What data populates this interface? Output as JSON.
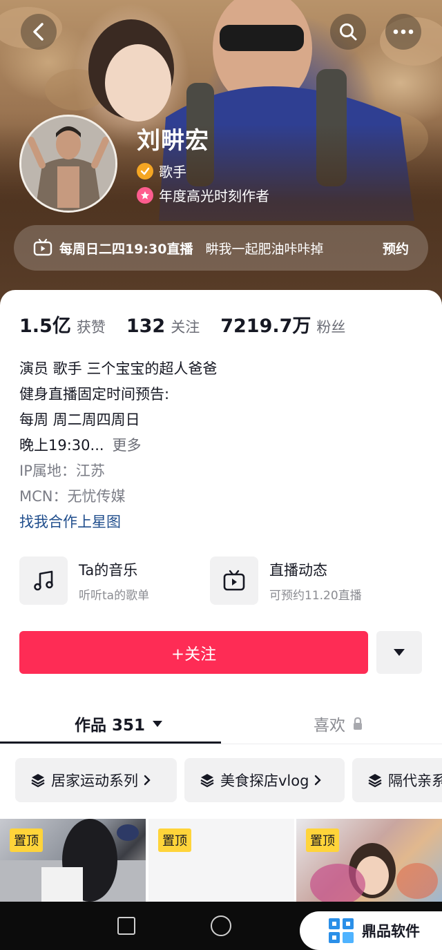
{
  "header": {
    "name": "刘畊宏",
    "tags": [
      {
        "label": "歌手",
        "icon": "verified-icon"
      },
      {
        "label": "年度高光时刻作者",
        "icon": "star-badge-icon"
      }
    ],
    "live_notice": {
      "time": "每周日二四19:30直播",
      "desc": "畊我一起肥油咔咔掉",
      "action": "预约"
    }
  },
  "stats": [
    {
      "num": "1.5亿",
      "label": "获赞"
    },
    {
      "num": "132",
      "label": "关注"
    },
    {
      "num": "7219.7万",
      "label": "粉丝"
    }
  ],
  "bio": {
    "line1": "演员 歌手 三个宝宝的超人爸爸",
    "line2": "健身直播固定时间预告:",
    "line3": "每周 周二周四周日",
    "line4": "晚上19:30...",
    "more": "更多",
    "ip": "IP属地：江苏",
    "mcn": "MCN：无忧传媒",
    "link": "找我合作上星图"
  },
  "cards": [
    {
      "title": "Ta的音乐",
      "sub": "听听ta的歌单",
      "icon": "music-note-icon"
    },
    {
      "title": "直播动态",
      "sub": "可预约11.20直播",
      "icon": "tv-play-icon"
    }
  ],
  "follow_label": "+关注",
  "tabs": {
    "works": "作品 351",
    "likes": "喜欢"
  },
  "collections": [
    "居家运动系列",
    "美食探店vlog",
    "隔代亲系"
  ],
  "pin_label": "置顶",
  "watermark": "鼎品软件",
  "colors": {
    "accent": "#fe2c55",
    "link": "#1f4d8c",
    "pin": "#ffd43a"
  }
}
